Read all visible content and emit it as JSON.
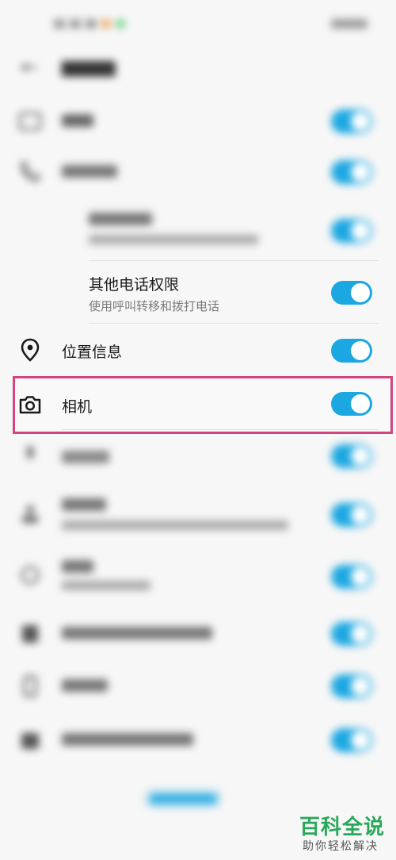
{
  "header": {
    "title": "",
    "back_icon": "arrow-left-icon"
  },
  "permissions": {
    "other_phone": {
      "label": "其他电话权限",
      "sub": "使用呼叫转移和拨打电话",
      "enabled": true
    },
    "location": {
      "label": "位置信息",
      "icon": "location-pin-icon",
      "enabled": true
    },
    "camera": {
      "label": "相机",
      "icon": "camera-icon",
      "enabled": true
    }
  },
  "watermark": {
    "title": "百科全说",
    "subtitle": "助你轻松解决"
  },
  "colors": {
    "toggle_on": "#1ba7e1",
    "highlight": "#d2457e",
    "brand_green": "#29a85b"
  }
}
